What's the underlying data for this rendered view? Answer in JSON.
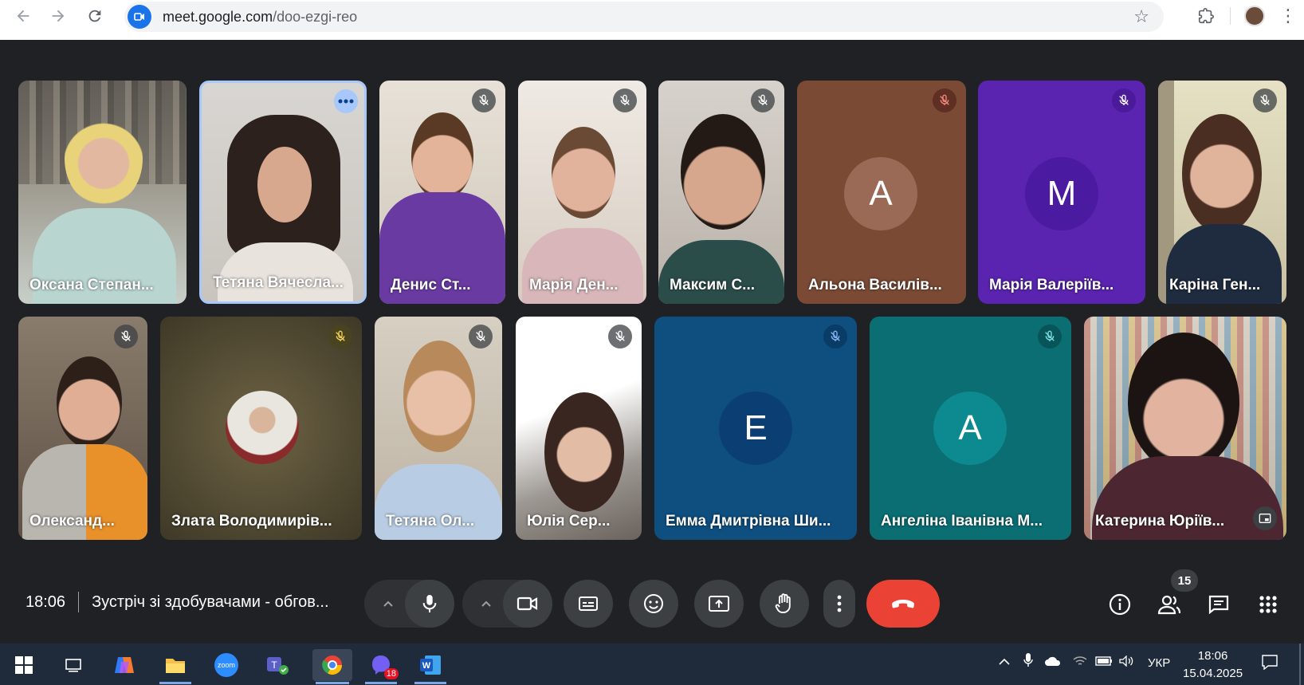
{
  "browser": {
    "url_host": "meet.google.com",
    "url_path": "/doo-ezgi-reo"
  },
  "participants": {
    "row1": [
      {
        "name": "Оксана Степан..."
      },
      {
        "name": "Тетяна Вячесла..."
      },
      {
        "name": "Денис Ст..."
      },
      {
        "name": "Марія Ден..."
      },
      {
        "name": "Максим С..."
      },
      {
        "name": "Альона Василів...",
        "initial": "А"
      },
      {
        "name": "Марія Валеріїв...",
        "initial": "М"
      },
      {
        "name": "Каріна Ген..."
      }
    ],
    "row2": [
      {
        "name": "Олександ..."
      },
      {
        "name": "Злата Володимирів..."
      },
      {
        "name": "Тетяна Ол..."
      },
      {
        "name": "Юлія Сер..."
      },
      {
        "name": "Емма Дмитрівна Ши...",
        "initial": "Е"
      },
      {
        "name": "Ангеліна Іванівна М...",
        "initial": "А"
      },
      {
        "name": "Катерина Юріїв..."
      }
    ]
  },
  "meeting": {
    "time": "18:06",
    "title": "Зустріч зі здобувачами - обгов..."
  },
  "people_count": "15",
  "taskbar": {
    "viber_badge": "18",
    "lang": "УКР",
    "time": "18:06",
    "date": "15.04.2025"
  },
  "colors": {
    "end_call": "#ea4335",
    "tile_brown": "#7a4a35",
    "tile_purple": "#5a24b0",
    "tile_blue": "#0e4f80",
    "tile_teal": "#0a6e73"
  }
}
